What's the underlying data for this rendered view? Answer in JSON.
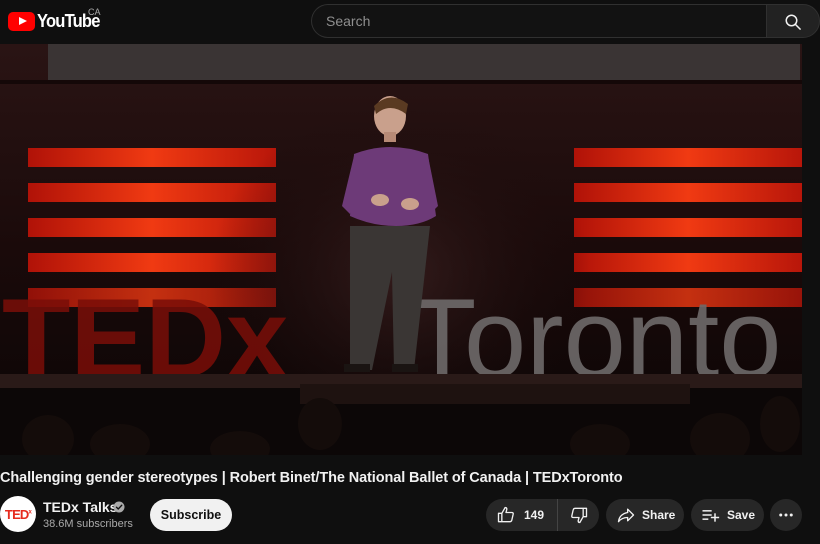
{
  "header": {
    "logo_text": "YouTube",
    "region": "CA",
    "search_placeholder": "Search"
  },
  "video": {
    "stage_sign_left": "TEDx",
    "stage_sign_right": "Toronto"
  },
  "title": "Challenging gender stereotypes | Robert Binet/The National Ballet of Canada | TEDxToronto",
  "channel": {
    "avatar_text": "TED",
    "avatar_sup": "x",
    "name": "TEDx Talks",
    "subscribers": "38.6M subscribers",
    "subscribe_label": "Subscribe"
  },
  "actions": {
    "likes": "149",
    "share_label": "Share",
    "save_label": "Save"
  },
  "colors": {
    "background": "#0f0f0f",
    "logo_red": "#ff0000",
    "pill": "#272727",
    "ted_red": "#e62b1e"
  }
}
